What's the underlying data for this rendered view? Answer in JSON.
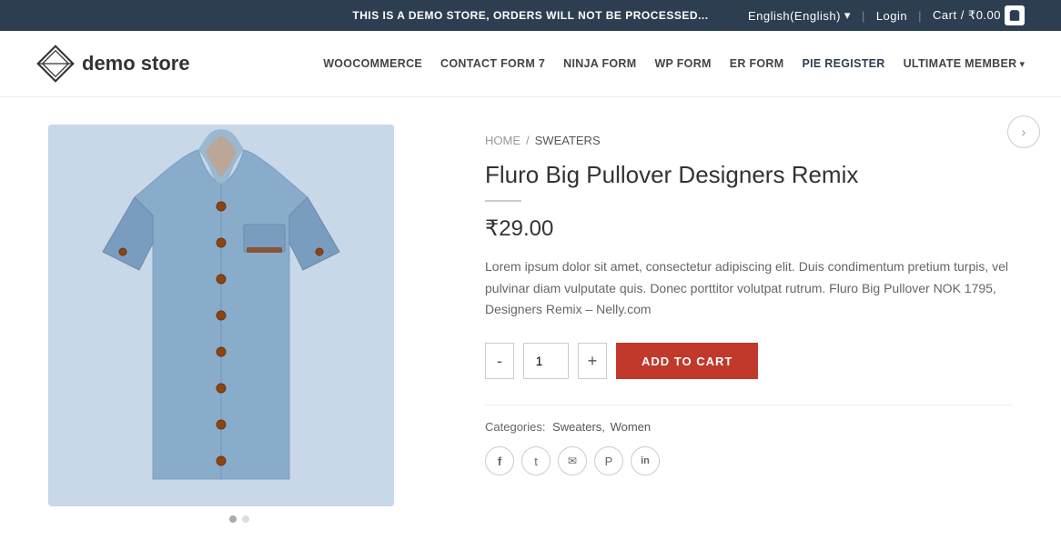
{
  "banner": {
    "message": "THIS IS A DEMO STORE, ORDERS WILL NOT BE PROCESSED...",
    "language": "English(English)",
    "login_label": "Login",
    "cart_label": "Cart / ₹0.00"
  },
  "header": {
    "logo_text_plain": "demo ",
    "logo_text_bold": "store",
    "nav_items": [
      {
        "id": "woocommerce",
        "label": "WOOCOMMERCE"
      },
      {
        "id": "contact-form-7",
        "label": "CONTACT FORM 7"
      },
      {
        "id": "ninja-form",
        "label": "NINJA FORM"
      },
      {
        "id": "wp-form",
        "label": "WP FORM"
      },
      {
        "id": "er-form",
        "label": "ER FORM"
      },
      {
        "id": "pie-register",
        "label": "PIE REGISTER"
      },
      {
        "id": "ultimate-member",
        "label": "ULTIMATE MEMBER"
      }
    ]
  },
  "breadcrumb": {
    "home": "HOME",
    "separator": "/",
    "current": "SWEATERS"
  },
  "product": {
    "title": "Fluro Big Pullover Designers Remix",
    "price": "₹29.00",
    "description": "Lorem ipsum dolor sit amet, consectetur adipiscing elit. Duis condimentum pretium turpis, vel pulvinar diam vulputate quis. Donec porttitor volutpat rutrum. Fluro Big Pullover NOK 1795, Designers Remix – Nelly.com",
    "quantity": "1",
    "add_to_cart": "ADD TO CART",
    "categories_label": "Categories:",
    "categories": "Sweaters, Women",
    "category_links": [
      "Sweaters",
      "Women"
    ]
  },
  "quantity": {
    "minus": "-",
    "plus": "+"
  },
  "social": {
    "icons": [
      "f",
      "t",
      "✉",
      "♡",
      "in"
    ]
  },
  "colors": {
    "banner_bg": "#2d3e50",
    "add_to_cart_bg": "#c0392b",
    "accent": "#c0392b"
  }
}
